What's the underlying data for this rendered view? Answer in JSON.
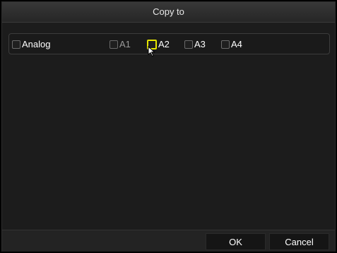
{
  "dialog": {
    "title": "Copy to"
  },
  "channels": {
    "group_label": "Analog",
    "items": [
      {
        "label": "A1",
        "checked": false,
        "state": "disabled"
      },
      {
        "label": "A2",
        "checked": false,
        "state": "focused"
      },
      {
        "label": "A3",
        "checked": false,
        "state": "normal"
      },
      {
        "label": "A4",
        "checked": false,
        "state": "normal"
      }
    ]
  },
  "footer": {
    "ok_label": "OK",
    "cancel_label": "Cancel"
  },
  "colors": {
    "focus": "#e6e600",
    "background": "#1c1c1c"
  }
}
